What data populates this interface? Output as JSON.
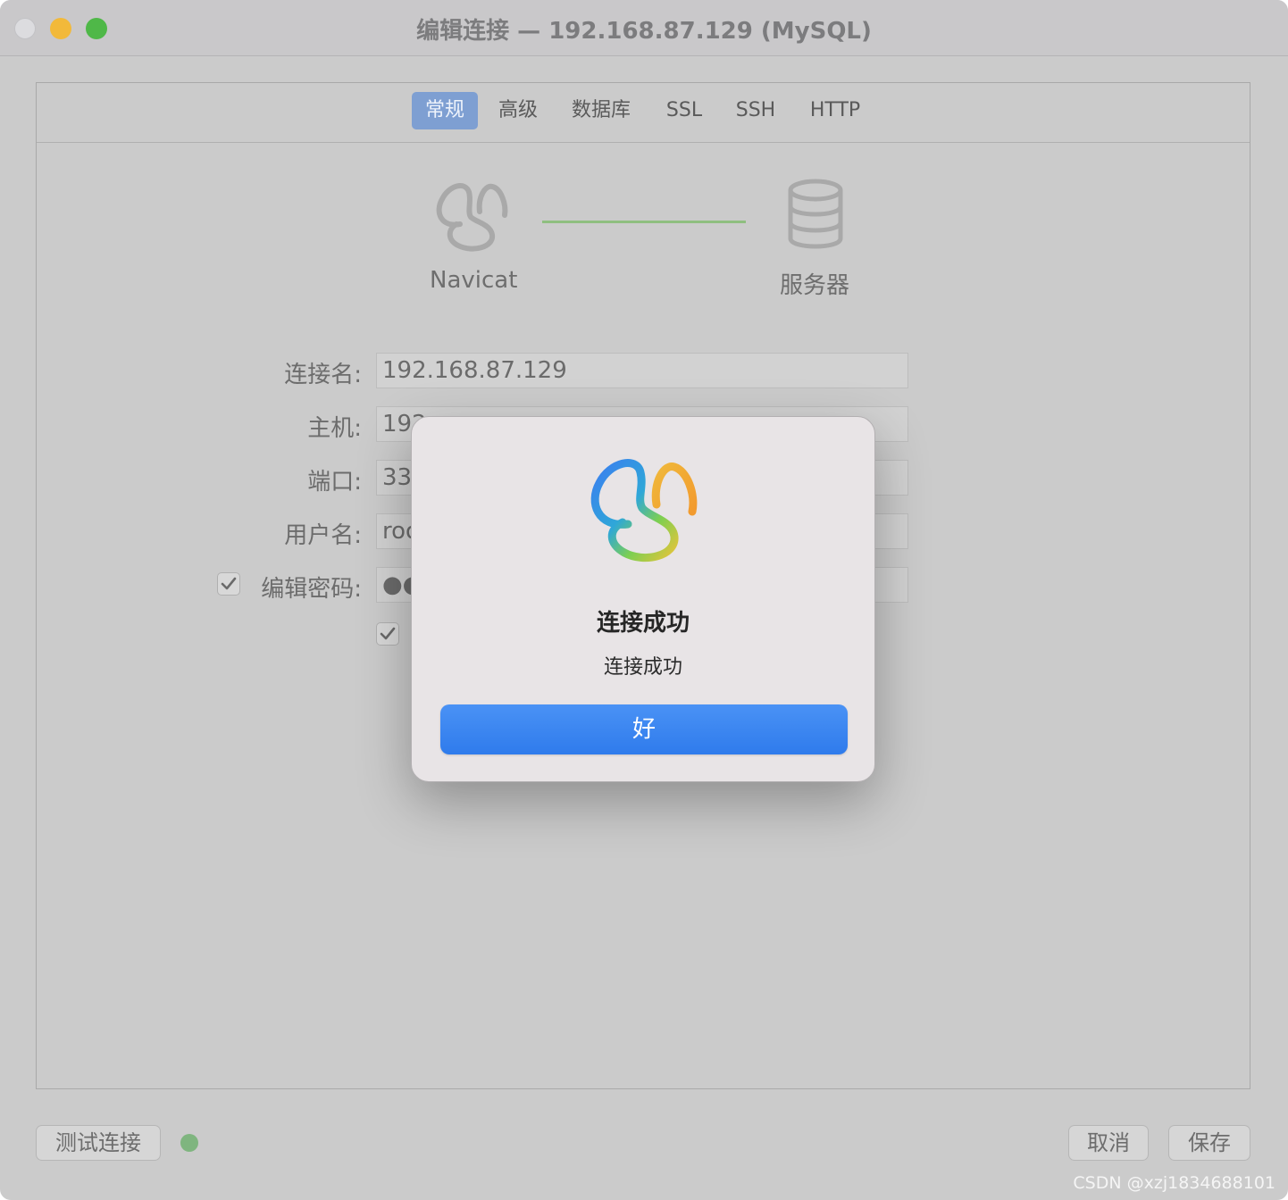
{
  "window": {
    "title": "编辑连接 — 192.168.87.129 (MySQL)"
  },
  "tabs": [
    {
      "label": "常规",
      "active": true
    },
    {
      "label": "高级",
      "active": false
    },
    {
      "label": "数据库",
      "active": false
    },
    {
      "label": "SSL",
      "active": false
    },
    {
      "label": "SSH",
      "active": false
    },
    {
      "label": "HTTP",
      "active": false
    }
  ],
  "diagram": {
    "client_label": "Navicat",
    "server_label": "服务器",
    "client_icon": "navicat-logo-icon",
    "server_icon": "database-icon",
    "link_color": "#8fbf80"
  },
  "form": {
    "connection_name_label": "连接名:",
    "connection_name_value": "192.168.87.129",
    "host_label": "主机:",
    "host_value": "192",
    "port_label": "端口:",
    "port_value": "33",
    "username_label": "用户名:",
    "username_value": "roo",
    "password_label": "编辑密码:",
    "password_value": "●●",
    "edit_password_checked": true,
    "save_password_checked": true
  },
  "footer": {
    "test_button": "测试连接",
    "status_color": "#7fb57f",
    "cancel_button": "取消",
    "save_button": "保存"
  },
  "dialog": {
    "icon": "navicat-logo-icon",
    "title": "连接成功",
    "message": "连接成功",
    "ok_button": "好",
    "accent": "#3a86f0"
  },
  "watermark": "CSDN @xzj1834688101"
}
